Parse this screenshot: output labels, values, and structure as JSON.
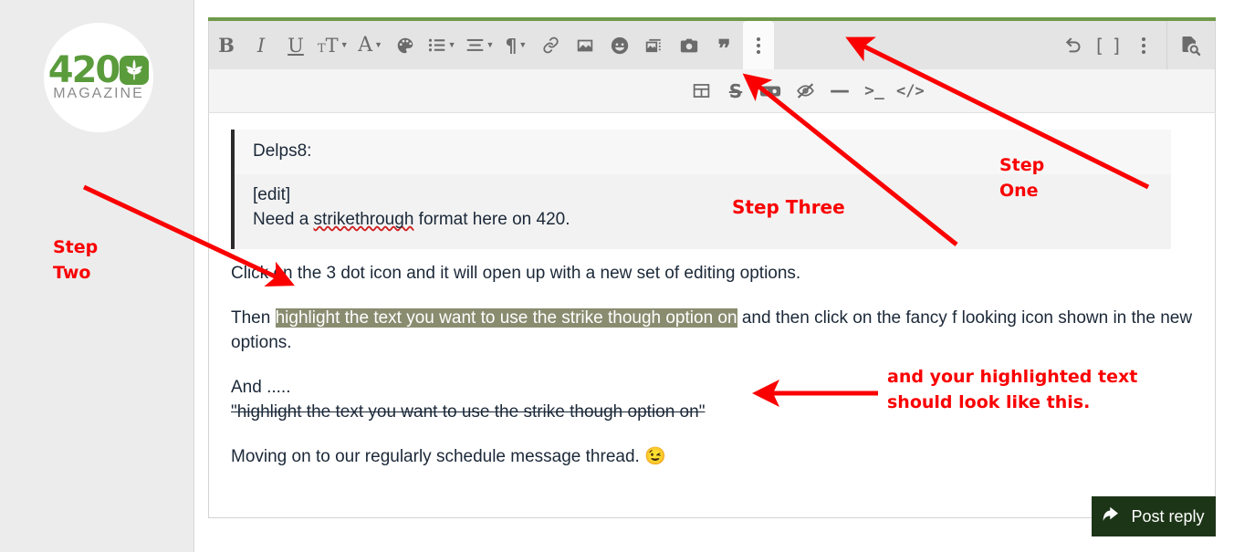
{
  "page": {
    "background": "#ffffff",
    "accent_green": "#6f9a4a",
    "annotation_color": "#fa0000",
    "highlight_color": "#8a8c70",
    "post_button_color": "#1d3517"
  },
  "sidebar": {
    "avatar": {
      "name": "420-magazine-logo",
      "brand_number": "420",
      "brand_word": "MAGAZINE",
      "registered_mark": "®",
      "leaf_icon": "cannabis-leaf-icon"
    }
  },
  "toolbar": {
    "row1": [
      {
        "name": "bold-button",
        "glyph": "B",
        "label": "Bold",
        "caret": false
      },
      {
        "name": "italic-button",
        "glyph": "I",
        "label": "Italic",
        "caret": false
      },
      {
        "name": "underline-button",
        "glyph": "U",
        "label": "Underline",
        "caret": false
      },
      {
        "name": "font-size-button",
        "glyph": "TT",
        "label": "Font size",
        "caret": true
      },
      {
        "name": "font-family-button",
        "glyph": "A",
        "label": "Font",
        "caret": true
      },
      {
        "name": "text-color-button",
        "glyph": "palette-icon",
        "label": "Text color",
        "caret": false
      },
      {
        "name": "list-button",
        "glyph": "list-icon",
        "label": "List",
        "caret": true
      },
      {
        "name": "align-button",
        "glyph": "align-icon",
        "label": "Alignment",
        "caret": true
      },
      {
        "name": "paragraph-button",
        "glyph": "¶",
        "label": "Paragraph format",
        "caret": true
      },
      {
        "name": "link-button",
        "glyph": "link-icon",
        "label": "Insert link",
        "caret": false
      },
      {
        "name": "image-button",
        "glyph": "image-icon",
        "label": "Insert image",
        "caret": false
      },
      {
        "name": "emoji-button",
        "glyph": "smiley-icon",
        "label": "Smilies",
        "caret": false
      },
      {
        "name": "gallery-button",
        "glyph": "gallery-icon",
        "label": "Gallery",
        "caret": false
      },
      {
        "name": "camera-button",
        "glyph": "camera-icon",
        "label": "Camera",
        "caret": false
      },
      {
        "name": "quote-button",
        "glyph": "❞",
        "label": "Quote",
        "caret": false
      },
      {
        "name": "more-options-button",
        "glyph": "kebab-icon",
        "label": "More options",
        "caret": false,
        "active": true
      }
    ],
    "row1_right": [
      {
        "name": "undo-button",
        "glyph": "undo-icon",
        "label": "Undo"
      },
      {
        "name": "bbcode-button",
        "glyph": "[ ]",
        "label": "Toggle BB code"
      },
      {
        "name": "overflow-button",
        "glyph": "kebab-icon",
        "label": "More"
      }
    ],
    "row1_far_right": [
      {
        "name": "preview-button",
        "glyph": "document-search-icon",
        "label": "Preview"
      }
    ],
    "row2": [
      {
        "name": "table-button",
        "glyph": "table-icon",
        "label": "Insert table"
      },
      {
        "name": "strikethrough-button",
        "glyph": "S",
        "label": "Strike through"
      },
      {
        "name": "spoiler-button",
        "glyph": "mask-icon",
        "label": "Spoiler"
      },
      {
        "name": "hide-button",
        "glyph": "eye-slash-icon",
        "label": "Hide"
      },
      {
        "name": "horizontal-rule-button",
        "glyph": "—",
        "label": "Horizontal line"
      },
      {
        "name": "code-block-button",
        "glyph": ">_",
        "label": "Code block"
      },
      {
        "name": "inline-code-button",
        "glyph": "</>",
        "label": "Inline code"
      }
    ]
  },
  "editor": {
    "quote": {
      "author": "Delps8:",
      "line1": "[edit]",
      "line2_prefix": "Need a ",
      "line2_misspelled": "strikethrough",
      "line2_suffix": " format here on 420."
    },
    "paragraphs": {
      "p1": "Click on the 3 dot icon and it will open up with a new set of editing options.",
      "p2_prefix": "Then ",
      "p2_highlighted": "highlight the text you want to use the strike though option on",
      "p2_suffix": " and then click on the fancy f looking icon shown in the new options.",
      "p3": "And .....",
      "p4": "\"highlight the text you want to use the strike though option on\"",
      "p5": "Moving on to our regularly schedule message thread.",
      "p5_emoji": "😉"
    }
  },
  "footer": {
    "post_reply_label": "Post reply",
    "post_reply_icon": "reply-arrow-icon"
  },
  "annotations": {
    "step_one": "Step\nOne",
    "step_two": "Step\nTwo",
    "step_three": "Step Three",
    "highlight_note": "and your highlighted text\nshould look like this."
  }
}
